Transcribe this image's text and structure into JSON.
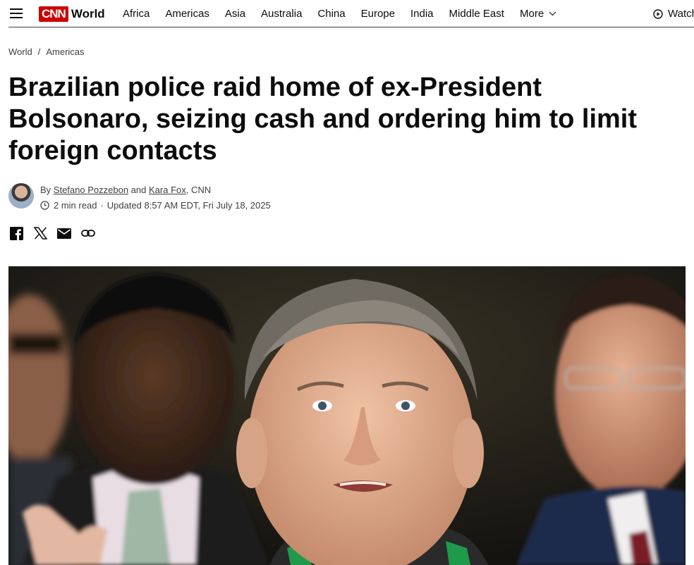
{
  "nav": {
    "logo_text": "CNN",
    "section": "World",
    "links": [
      "Africa",
      "Americas",
      "Asia",
      "Australia",
      "China",
      "Europe",
      "India",
      "Middle East"
    ],
    "more_label": "More",
    "watch_label": "Watch"
  },
  "breadcrumb": {
    "level1": "World",
    "separator": "/",
    "level2": "Americas"
  },
  "headline": "Brazilian police raid home of ex-President Bolsonaro, seizing cash and ordering him to limit foreign contacts",
  "byline": {
    "prefix": "By",
    "author1": "Stefano Pozzebon",
    "conjunction": "and",
    "author2": "Kara Fox",
    "org": ", CNN",
    "read_time": "2 min read",
    "separator": "·",
    "updated": "Updated 8:57 AM EDT, Fri July 18, 2025"
  },
  "share_icons": [
    "facebook-icon",
    "x-icon",
    "email-icon",
    "link-icon"
  ],
  "colors": {
    "brand": "#cc0000",
    "text": "#0c0c0c",
    "muted": "#404040"
  }
}
